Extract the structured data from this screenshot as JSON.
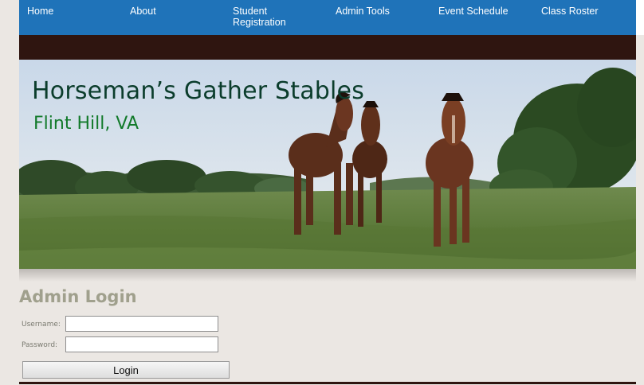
{
  "nav": {
    "items": [
      {
        "label": "Home"
      },
      {
        "label": "About"
      },
      {
        "label": "Student\nRegistration"
      },
      {
        "label": "Admin Tools"
      },
      {
        "label": "Event Schedule"
      },
      {
        "label": "Class Roster"
      }
    ]
  },
  "banner": {
    "title": "Horseman’s Gather Stables",
    "subtitle": "Flint Hill, VA"
  },
  "login": {
    "heading": "Admin Login",
    "username_label": "Username:",
    "password_label": "Password:",
    "username_value": "",
    "password_value": "",
    "button_label": "Login"
  },
  "colors": {
    "nav_bg": "#1f73b9",
    "brown_bar": "#2f1510",
    "page_bg": "#ebe7e3",
    "title_color": "#0b3d2c",
    "subtitle_color": "#127a2a",
    "login_heading_color": "#a0a08d"
  }
}
